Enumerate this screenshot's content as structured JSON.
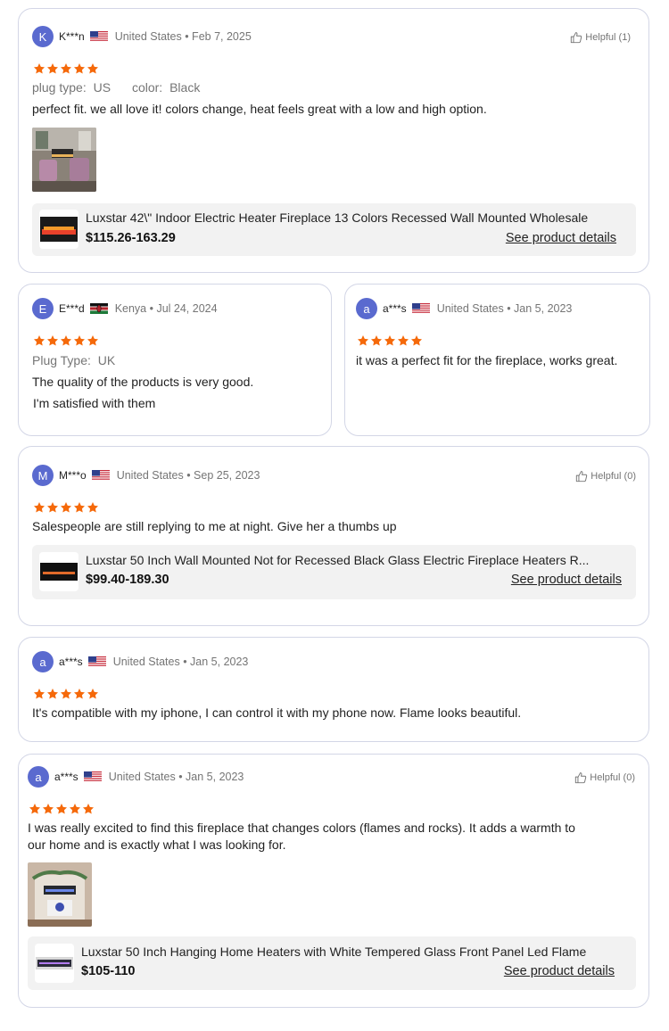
{
  "colors": {
    "star": "#f5690a",
    "avatar": "#5a6acf",
    "card_border": "#d3d6e6",
    "product_bg": "#f2f2f2",
    "meta_text": "#757575"
  },
  "icons": {
    "helpful": "thumbs-up-icon",
    "star": "star-icon"
  },
  "reviews": [
    {
      "avatar": "K",
      "user": "K***n",
      "flag": "us-flag-icon",
      "meta": "United States • Feb 7, 2025",
      "helpful": "Helpful (1)",
      "rating": 5,
      "attrs": [
        {
          "label": "plug type:",
          "value": "US"
        },
        {
          "label": "color:",
          "value": "Black"
        }
      ],
      "text": "perfect fit. we all love it! colors change, heat feels great with a low and high option.",
      "product": {
        "title": "Luxstar 42\\\" Indoor Electric Heater Fireplace 13 Colors Recessed Wall Mounted Wholesale",
        "price": "$115.26-163.29",
        "link": "See product details"
      }
    },
    {
      "avatar": "E",
      "user": "E***d",
      "flag": "kenya-flag-icon",
      "meta": "Kenya • Jul 24, 2024",
      "rating": 5,
      "attrs": [
        {
          "label": "Plug Type:",
          "value": "UK"
        }
      ],
      "text1": "The quality of the products is very good.",
      "text2": "I'm satisfied with them"
    },
    {
      "avatar": "a",
      "user": "a***s",
      "flag": "us-flag-icon",
      "meta": "United States • Jan 5, 2023",
      "rating": 5,
      "text": "it was a perfect fit for the fireplace, works great."
    },
    {
      "avatar": "M",
      "user": "M***o",
      "flag": "us-flag-icon",
      "meta": "United States • Sep 25, 2023",
      "helpful": "Helpful (0)",
      "rating": 5,
      "text": "Salespeople are still replying to me at night. Give her a thumbs up",
      "product": {
        "title": "Luxstar 50 Inch Wall Mounted Not for Recessed Black Glass Electric Fireplace Heaters R...",
        "price": "$99.40-189.30",
        "link": "See product details"
      }
    },
    {
      "avatar": "a",
      "user": "a***s",
      "flag": "us-flag-icon",
      "meta": "United States • Jan 5, 2023",
      "rating": 5,
      "text": "It's compatible with my iphone, I can control it with my phone now. Flame looks beautiful."
    },
    {
      "avatar": "a",
      "user": "a***s",
      "flag": "us-flag-icon",
      "meta": "United States • Jan 5, 2023",
      "helpful": "Helpful (0)",
      "rating": 5,
      "text1": "I was really excited to find this fireplace that changes colors (flames and rocks). It adds a warmth to",
      "text2": "our home and is exactly what I was  looking for.",
      "product": {
        "title": "Luxstar 50 Inch Hanging Home Heaters with White Tempered Glass Front Panel Led Flame",
        "price": "$105-110",
        "link": "See product details"
      }
    }
  ]
}
